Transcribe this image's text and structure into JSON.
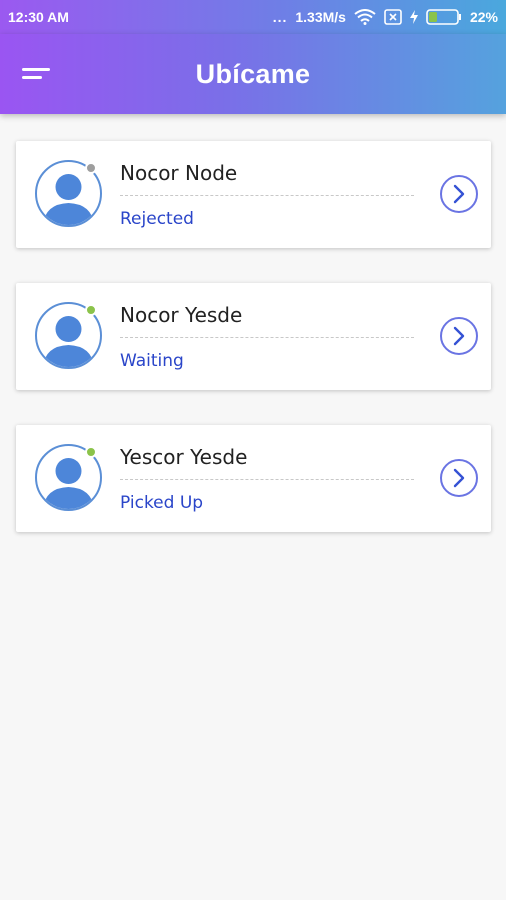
{
  "status_bar": {
    "time": "12:30 AM",
    "dots": "...",
    "speed": "1.33M/s",
    "battery": "22%",
    "icons": [
      "wifi-icon",
      "sim-x-icon",
      "charging-icon",
      "battery-icon"
    ]
  },
  "app_bar": {
    "title": "Ubícame",
    "menu_icon": "hamburger-menu-icon"
  },
  "colors": {
    "accent_start": "#9a55f2",
    "accent_end": "#55a2de",
    "status_link": "#2a45c9",
    "dot_rejected": "#9e9e9e",
    "dot_active": "#8bc34a"
  },
  "contacts": [
    {
      "name": "Nocor Node",
      "status": "Rejected",
      "presence": "offline"
    },
    {
      "name": "Nocor Yesde",
      "status": "Waiting",
      "presence": "online"
    },
    {
      "name": "Yescor Yesde",
      "status": "Picked Up",
      "presence": "online"
    }
  ]
}
